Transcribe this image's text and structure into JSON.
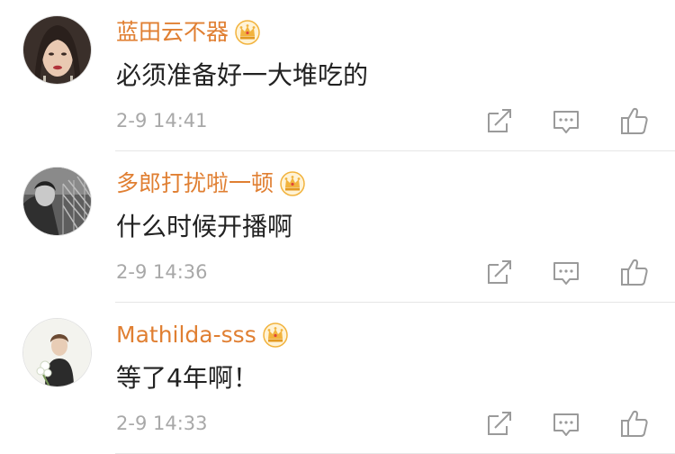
{
  "colors": {
    "username": "#e07f32",
    "text": "#222222",
    "time": "#a8a8a8",
    "icon": "#9a9a9a",
    "crown": "#f2b33d",
    "divider": "#e6e6e6"
  },
  "actions": {
    "forward_icon": "forward-icon",
    "comment_icon": "comment-icon",
    "like_icon": "thumbs-up-icon"
  },
  "comments": [
    {
      "username": "蓝田云不器",
      "badge": "crown-icon",
      "text": "必须准备好一大堆吃的",
      "time": "2-9 14:41"
    },
    {
      "username": "多郎打扰啦一顿",
      "badge": "crown-icon",
      "text": "什么时候开播啊",
      "time": "2-9 14:36"
    },
    {
      "username": "Mathilda-sss",
      "badge": "crown-icon",
      "text": "等了4年啊！",
      "time": "2-9 14:33"
    }
  ]
}
